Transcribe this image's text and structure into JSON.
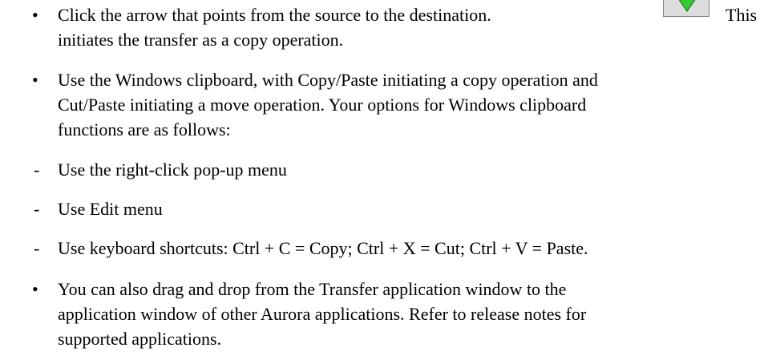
{
  "bullets": [
    {
      "line1": "Click the arrow that points from the source to the destination.",
      "after_icon": "This",
      "line2": "initiates the transfer as a copy operation."
    },
    {
      "lines": [
        "Use the Windows clipboard, with Copy/Paste initiating a copy operation and",
        "Cut/Paste initiating a move operation. Your options for Windows clipboard",
        "functions are as follows:"
      ],
      "subitems": [
        "Use the right-click pop-up menu",
        "Use Edit menu",
        "Use keyboard shortcuts: Ctrl + C = Copy; Ctrl + X = Cut; Ctrl + V = Paste."
      ]
    },
    {
      "lines": [
        "You can also drag and drop from the Transfer application window to the",
        "application window of other Aurora applications. Refer to release notes for",
        "supported applications."
      ]
    }
  ],
  "bullet_char": "•",
  "dash_char": "-",
  "icons": {
    "transfer_arrow": "green-arrow-icon"
  },
  "colors": {
    "arrow_fill": "#33cc33",
    "arrow_stroke": "#1a7a1a",
    "button_bg": "#dcdcdc"
  }
}
